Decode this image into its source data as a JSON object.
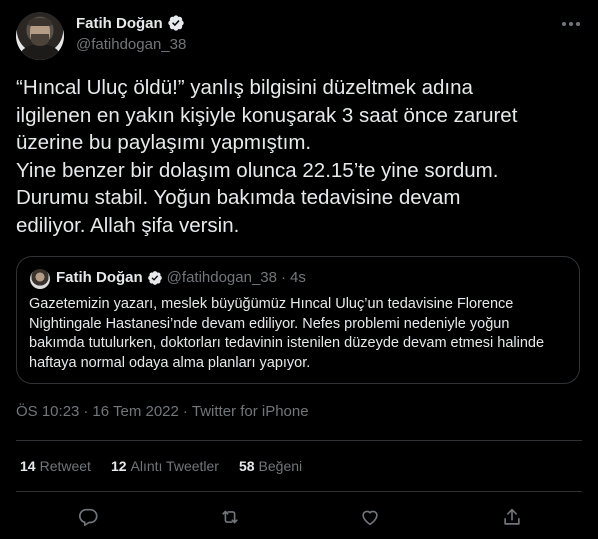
{
  "author": {
    "name": "Fatih Doğan",
    "handle": "@fatihdogan_38",
    "verified_icon": "verified-badge-icon"
  },
  "tweet": {
    "text": "“Hıncal Uluç öldü!” yanlış bilgisini düzeltmek adına\nilgilenen en yakın kişiyle konuşarak 3 saat önce zaruret\nüzerine bu paylaşımı yapmıştım.\nYine benzer bir dolaşım olunca 22.15’te yine sordum.\nDurumu stabil. Yoğun bakımda tedavisine devam\nediliyor. Allah şifa versin."
  },
  "quoted": {
    "name": "Fatih Doğan",
    "handle": "@fatihdogan_38",
    "dot": "·",
    "time": "4s",
    "text": "Gazetemizin yazarı, meslek büyüğümüz Hıncal Uluç’un tedavisine Florence Nightingale Hastanesi’nde devam ediliyor. Nefes problemi nedeniyle yoğun bakımda tutulurken, doktorları tedavinin istenilen düzeyde devam etmesi halinde haftaya normal odaya alma planları yapıyor."
  },
  "meta": {
    "time": "ÖS 10:23",
    "sep1": "·",
    "date": "16 Tem 2022",
    "sep2": "·",
    "source": "Twitter for iPhone"
  },
  "stats": {
    "retweets": {
      "count": "14",
      "label": "Retweet"
    },
    "quotes": {
      "count": "12",
      "label": "Alıntı Tweetler"
    },
    "likes": {
      "count": "58",
      "label": "Beğeni"
    }
  },
  "actions": [
    "reply-icon",
    "retweet-icon",
    "like-icon",
    "share-icon"
  ],
  "colors": {
    "background": "#000000",
    "text": "#e7e9ea",
    "secondary": "#71767b",
    "border": "#2f3336",
    "verified": "#1d9bf0"
  }
}
